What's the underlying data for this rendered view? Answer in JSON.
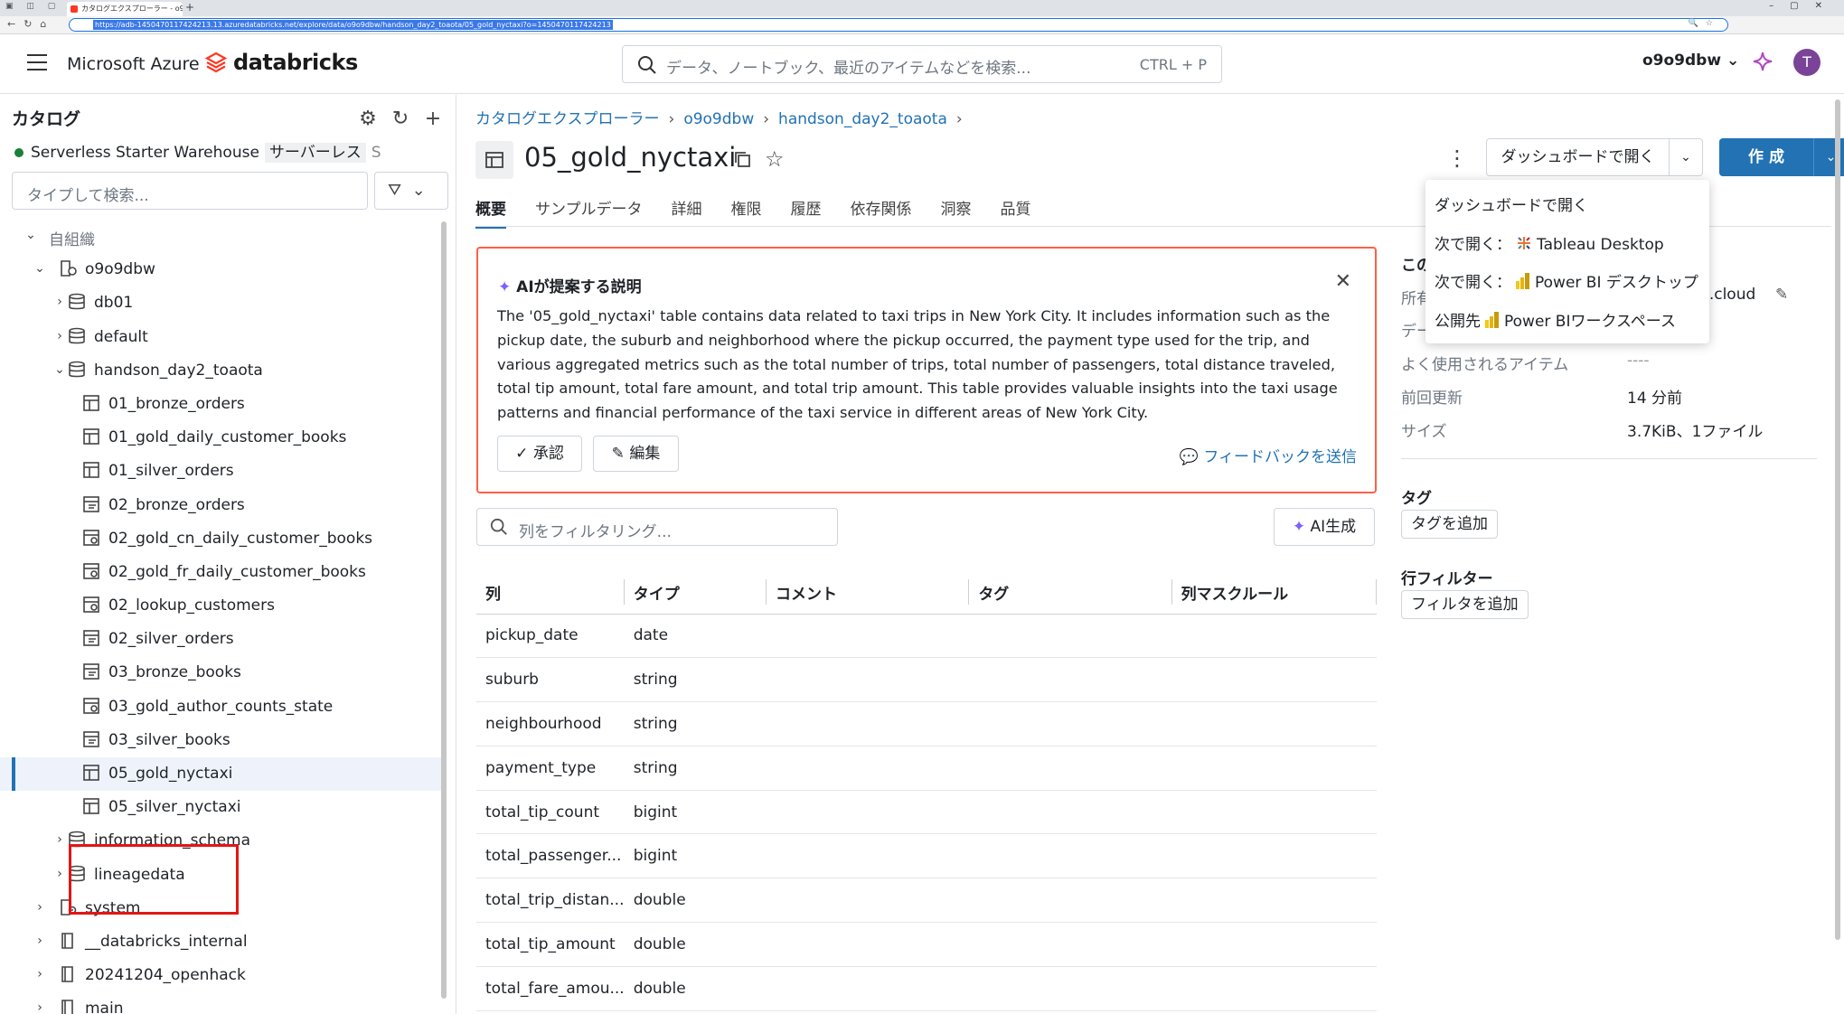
{
  "browser": {
    "tab_title": "カタログエクスプローラー - o9o9dbw",
    "address": "https://adb-1450470117424213.13.azuredatabricks.net/explore/data/o9o9dbw/handson_day2_toaota/05_gold_nyctaxi?o=1450470117424213"
  },
  "header": {
    "brand_azure": "Microsoft Azure",
    "brand_databricks": "databricks",
    "search_placeholder": "データ、ノートブック、最近のアイテムなどを検索...",
    "search_shortcut": "CTRL + P",
    "workspace": "o9o9dbw",
    "avatar_letter": "T"
  },
  "sidebar": {
    "title": "カタログ",
    "warehouse_name": "Serverless Starter Warehouse",
    "warehouse_badge": "サーバーレス",
    "warehouse_extra": "S",
    "search_placeholder": "タイプして検索...",
    "tree": [
      {
        "label": "自組織",
        "level": 0,
        "chevron": "down",
        "icon": "none",
        "muted": true
      },
      {
        "label": "o9o9dbw",
        "level": 1,
        "chevron": "down",
        "icon": "catalog"
      },
      {
        "label": "db01",
        "level": 2,
        "chevron": "right",
        "icon": "schema"
      },
      {
        "label": "default",
        "level": 2,
        "chevron": "right",
        "icon": "schema"
      },
      {
        "label": "handson_day2_toaota",
        "level": 2,
        "chevron": "down",
        "icon": "schema"
      },
      {
        "label": "01_bronze_orders",
        "level": 3,
        "chevron": "none",
        "icon": "table"
      },
      {
        "label": "01_gold_daily_customer_books",
        "level": 3,
        "chevron": "none",
        "icon": "table"
      },
      {
        "label": "01_silver_orders",
        "level": 3,
        "chevron": "none",
        "icon": "table"
      },
      {
        "label": "02_bronze_orders",
        "level": 3,
        "chevron": "none",
        "icon": "stream"
      },
      {
        "label": "02_gold_cn_daily_customer_books",
        "level": 3,
        "chevron": "none",
        "icon": "view"
      },
      {
        "label": "02_gold_fr_daily_customer_books",
        "level": 3,
        "chevron": "none",
        "icon": "view"
      },
      {
        "label": "02_lookup_customers",
        "level": 3,
        "chevron": "none",
        "icon": "view"
      },
      {
        "label": "02_silver_orders",
        "level": 3,
        "chevron": "none",
        "icon": "stream"
      },
      {
        "label": "03_bronze_books",
        "level": 3,
        "chevron": "none",
        "icon": "stream"
      },
      {
        "label": "03_gold_author_counts_state",
        "level": 3,
        "chevron": "none",
        "icon": "view"
      },
      {
        "label": "03_silver_books",
        "level": 3,
        "chevron": "none",
        "icon": "stream"
      },
      {
        "label": "05_gold_nyctaxi",
        "level": 3,
        "chevron": "none",
        "icon": "table",
        "selected": true
      },
      {
        "label": "05_silver_nyctaxi",
        "level": 3,
        "chevron": "none",
        "icon": "table"
      },
      {
        "label": "information_schema",
        "level": 2,
        "chevron": "right",
        "icon": "schema"
      },
      {
        "label": "lineagedata",
        "level": 2,
        "chevron": "right",
        "icon": "schema"
      },
      {
        "label": "system",
        "level": 1,
        "chevron": "right",
        "icon": "system"
      },
      {
        "label": "__databricks_internal",
        "level": 1,
        "chevron": "right",
        "icon": "catalog-plain"
      },
      {
        "label": "20241204_openhack",
        "level": 1,
        "chevron": "right",
        "icon": "catalog-plain"
      },
      {
        "label": "main",
        "level": 1,
        "chevron": "right",
        "icon": "catalog-plain"
      }
    ]
  },
  "main": {
    "breadcrumb": [
      "カタログエクスプローラー",
      "o9o9dbw",
      "handson_day2_toaota"
    ],
    "title": "05_gold_nyctaxi",
    "open_dashboard_label": "ダッシュボードで開く",
    "create_label": "作 成",
    "tabs": [
      "概要",
      "サンプルデータ",
      "詳細",
      "権限",
      "履歴",
      "依存関係",
      "洞察",
      "品質"
    ],
    "ai_box": {
      "title": "AIが提案する説明",
      "text": "The '05_gold_nyctaxi' table contains data related to taxi trips in New York City. It includes information such as the pickup date, the suburb and neighborhood where the pickup occurred, the payment type used for the trip, and various aggregated metrics such as the total number of trips, total number of passengers, total distance traveled, total tip amount, total fare amount, and total trip amount. This table provides valuable insights into the taxi usage patterns and financial performance of the taxi service in different areas of New York City.",
      "approve_label": "承認",
      "edit_label": "編集",
      "feedback_label": "フィードバックを送信"
    },
    "column_filter_placeholder": "列をフィルタリング...",
    "ai_generate_label": "AI生成",
    "table_headers": [
      "列",
      "タイプ",
      "コメント",
      "タグ",
      "列マスクルール"
    ],
    "columns": [
      {
        "name": "pickup_date",
        "type": "date"
      },
      {
        "name": "suburb",
        "type": "string"
      },
      {
        "name": "neighbourhood",
        "type": "string"
      },
      {
        "name": "payment_type",
        "type": "string"
      },
      {
        "name": "total_tip_count",
        "type": "bigint"
      },
      {
        "name": "total_passenger...",
        "type": "bigint"
      },
      {
        "name": "total_trip_distan...",
        "type": "double"
      },
      {
        "name": "total_tip_amount",
        "type": "double"
      },
      {
        "name": "total_fare_amou...",
        "type": "double"
      }
    ]
  },
  "right_panel": {
    "section_title": "この",
    "owner_key": "所有",
    "owner_val": "9.cloud",
    "data_key": "デー",
    "frequent_key": "よく使用されるアイテム",
    "frequent_val": "----",
    "updated_key": "前回更新",
    "updated_val": "14 分前",
    "size_key": "サイズ",
    "size_val": "3.7KiB、1ファイル",
    "tags_title": "タグ",
    "add_tag_label": "タグを追加",
    "row_filter_title": "行フィルター",
    "add_filter_label": "フィルタを追加"
  },
  "dropdown": {
    "items": [
      {
        "prefix": "",
        "label": "ダッシュボードで開く",
        "icon": "none"
      },
      {
        "prefix": "次で開く：",
        "label": "Tableau Desktop",
        "icon": "tableau"
      },
      {
        "prefix": "次で開く：",
        "label": "Power BI デスクトップ",
        "icon": "powerbi"
      },
      {
        "prefix": "公開先",
        "label": "Power BIワークスペース",
        "icon": "powerbi"
      }
    ]
  },
  "colors": {
    "accent": "#2272b4",
    "highlight": "#e41515",
    "ai_border": "#ff5f46"
  }
}
